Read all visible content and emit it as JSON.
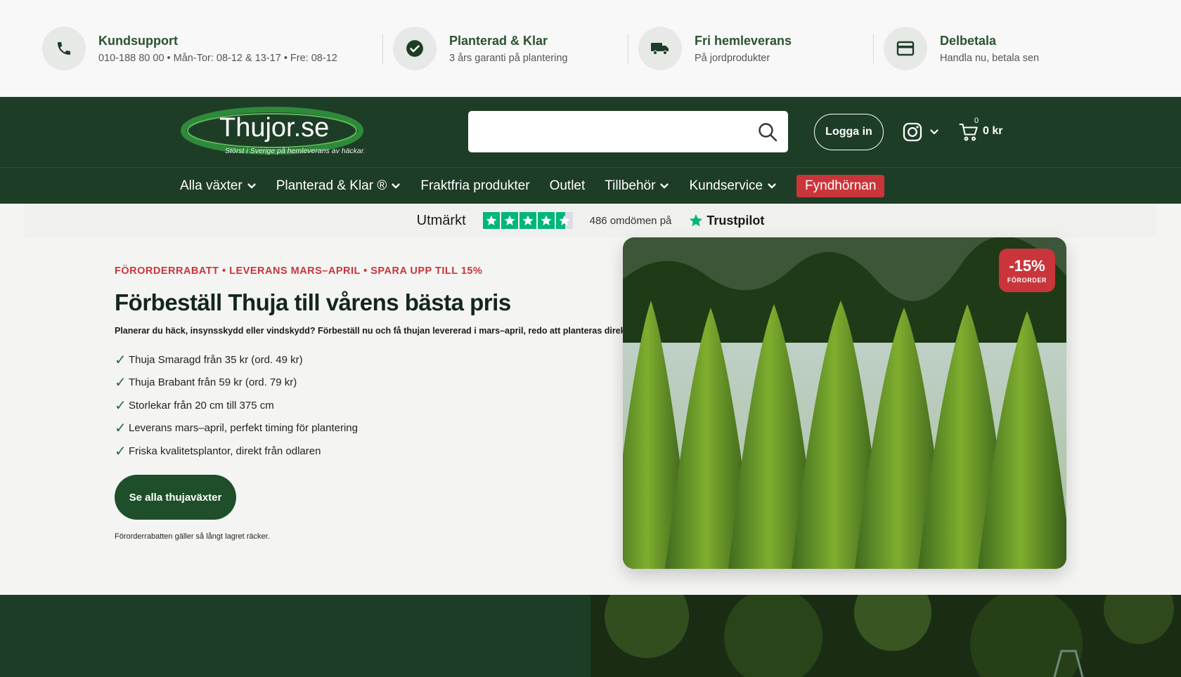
{
  "usp": [
    {
      "icon": "phone-icon",
      "title": "Kundsupport",
      "sub": "010-188 80 00 • Mån-Tor: 08-12 & 13-17 • Fre: 08-12"
    },
    {
      "icon": "check-circle-icon",
      "title": "Planterad & Klar",
      "sub": "3 års garanti på plantering"
    },
    {
      "icon": "truck-icon",
      "title": "Fri hemleverans",
      "sub": "På jordprodukter"
    },
    {
      "icon": "credit-card-icon",
      "title": "Delbetala",
      "sub": "Handla nu, betala sen"
    }
  ],
  "header": {
    "logo_text": "Thujor.se",
    "logo_tagline": "Störst i Sverige på hemleverans av häckar.",
    "search_placeholder": "",
    "login_label": "Logga in",
    "cart_count": "0",
    "cart_total": "0 kr"
  },
  "nav": [
    {
      "label": "Alla växter",
      "dropdown": true
    },
    {
      "label": "Planterad & Klar ®",
      "dropdown": true
    },
    {
      "label": "Fraktfria produkter",
      "dropdown": false
    },
    {
      "label": "Outlet",
      "dropdown": false
    },
    {
      "label": "Tillbehör",
      "dropdown": true
    },
    {
      "label": "Kundservice",
      "dropdown": true
    },
    {
      "label": "Fyndhörnan",
      "dropdown": false,
      "highlight": true
    }
  ],
  "trustpilot": {
    "label": "Utmärkt",
    "rating": 4.5,
    "count_text": "486 omdömen på",
    "brand": "Trustpilot"
  },
  "hero": {
    "eyebrow": "FÖRORDERRABATT • LEVERANS MARS–APRIL • SPARA UPP TILL 15%",
    "title": "Förbeställ Thuja till vårens bästa pris",
    "description": "Planerar du häck, insynsskydd eller vindskydd? Förbeställ nu och få thujan levererad i mars–april, redo att planteras direkt.",
    "bullets": [
      "Thuja Smaragd från 35 kr (ord. 49 kr)",
      "Thuja Brabant från 59 kr (ord. 79 kr)",
      "Storlekar från 20 cm till 375 cm",
      "Leverans mars–april, perfekt timing för plantering",
      "Friska kvalitetsplantor, direkt från odlaren"
    ],
    "cta_label": "Se alla thujaväxter",
    "note": "Förorderrabatten gäller så långt lagret räcker.",
    "badge_pct": "-15%",
    "badge_label": "FÖRORDER"
  },
  "colors": {
    "brand_green": "#1e3d26",
    "accent_red": "#c9353a",
    "trustpilot_green": "#00b67a"
  }
}
